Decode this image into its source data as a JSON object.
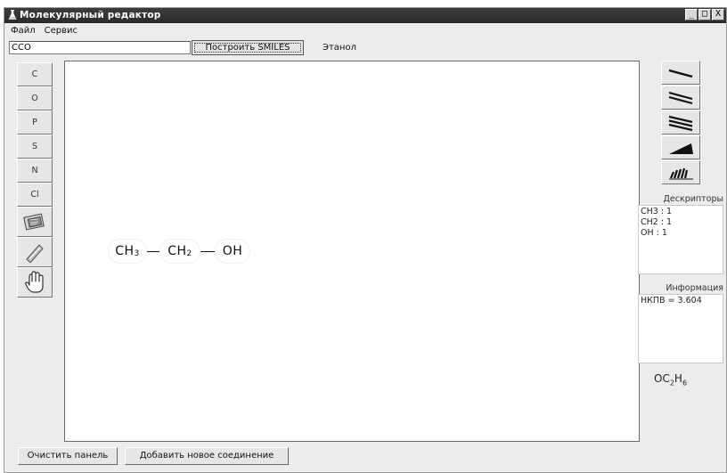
{
  "window": {
    "title": "Молекулярный редактор",
    "buttons": [
      "_",
      "□",
      "X"
    ]
  },
  "menu": {
    "items": [
      "Файл",
      "Сервис"
    ]
  },
  "smiles": {
    "value": "CCO",
    "build_label": "Построить SMILES",
    "compound_name": "Этанол"
  },
  "left_tools": {
    "text_buttons": [
      "C",
      "O",
      "P",
      "S",
      "N",
      "Cl"
    ],
    "icon_buttons": [
      "eraser-sheet-icon",
      "ruler-icon",
      "hand-icon"
    ]
  },
  "molecule": {
    "atoms": [
      {
        "symbol": "CH",
        "sub": "3"
      },
      {
        "symbol": "CH",
        "sub": "2"
      },
      {
        "symbol": "OH",
        "sub": ""
      }
    ]
  },
  "right_tools": {
    "icon_buttons": [
      "single-bond-icon",
      "double-bond-icon",
      "triple-bond-icon",
      "wedge-bond-icon",
      "hashed-wedge-bond-icon"
    ]
  },
  "descriptors": {
    "label": "Дескрипторы",
    "lines": [
      "CH3 : 1",
      "CH2 : 1",
      "OH : 1"
    ]
  },
  "information": {
    "label": "Информация",
    "lines": [
      "НКПВ = 3.604"
    ]
  },
  "formula": {
    "parts": [
      {
        "t": "OC",
        "s": "2"
      },
      {
        "t": "H",
        "s": "6"
      }
    ]
  },
  "bottom": {
    "clear_label": "Очистить панель",
    "add_label": "Добавить новое соединение"
  }
}
